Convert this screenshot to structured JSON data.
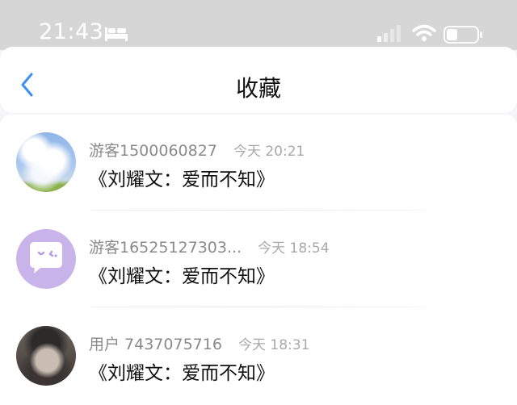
{
  "status_bar": {
    "time": "21:43",
    "icons": [
      "bed-icon",
      "signal-icon",
      "wifi-icon",
      "battery-icon"
    ]
  },
  "header": {
    "title": "收藏",
    "back_icon": "chevron-left-icon"
  },
  "colors": {
    "accent": "#3b8ff5",
    "status_bar_bg": "#d6d6d6",
    "meta_text": "#8a8a8a"
  },
  "items": [
    {
      "user": "游客1500060827",
      "time": "今天 20:21",
      "title": "《刘耀文：爱而不知》",
      "avatar": "sky-clouds-avatar"
    },
    {
      "user": "游客16525127303...",
      "time": "今天 18:54",
      "title": "《刘耀文：爱而不知》",
      "avatar": "chat-bubble-face-avatar"
    },
    {
      "user": "用户 7437075716",
      "time": "今天 18:31",
      "title": "《刘耀文：爱而不知》",
      "avatar": "person-photo-avatar"
    }
  ]
}
